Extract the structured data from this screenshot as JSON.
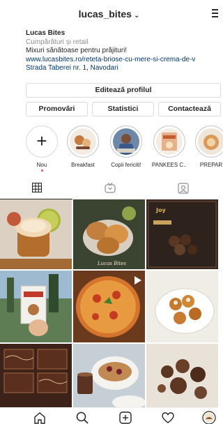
{
  "header": {
    "username": "lucas_bites",
    "chevron": "⌄",
    "menu_icon": "hamburger-menu-icon"
  },
  "bio": {
    "name": "Lucas Bites",
    "category": "Cumpărături și retail",
    "description": "Mixuri sănătoase pentru prăjituri!",
    "link": "www.lucasbites.ro/reteta-briose-cu-mere-si-crema-de-v",
    "address": "Strada Taberei nr. 1, Navodari"
  },
  "actions": {
    "edit_profile": "Editează profilul",
    "promotions": "Promovări",
    "insights": "Statistici",
    "contact": "Contactează"
  },
  "highlights": [
    {
      "label": "Nou",
      "icon": "plus-icon"
    },
    {
      "label": "Breakfast"
    },
    {
      "label": "Copii fericiti!"
    },
    {
      "label": "PANKEES C..."
    },
    {
      "label": "PREPAR"
    }
  ],
  "tabs": [
    {
      "name": "grid-icon"
    },
    {
      "name": "igtv-icon"
    },
    {
      "name": "tagged-icon"
    }
  ],
  "posts": [
    {
      "subject": "apple-muffins"
    },
    {
      "subject": "pies-with-apples",
      "caption": "Lucas Bites"
    },
    {
      "subject": "cocoa-balls-poster",
      "caption": "Joy"
    },
    {
      "subject": "hand-holding-box"
    },
    {
      "subject": "pizza",
      "video": true
    },
    {
      "subject": "donut-balls"
    },
    {
      "subject": "chocolate-brownies"
    },
    {
      "subject": "pancakes-with-tea"
    },
    {
      "subject": "chocolate-balls"
    }
  ],
  "bottom_nav": [
    {
      "name": "home-icon"
    },
    {
      "name": "search-icon"
    },
    {
      "name": "new-post-icon"
    },
    {
      "name": "activity-heart-icon"
    },
    {
      "name": "profile-avatar-icon"
    }
  ],
  "colors": {
    "link": "#00376b",
    "secondary": "#8e8e8e",
    "border": "#dbdbdb",
    "notify": "#ed4956"
  }
}
